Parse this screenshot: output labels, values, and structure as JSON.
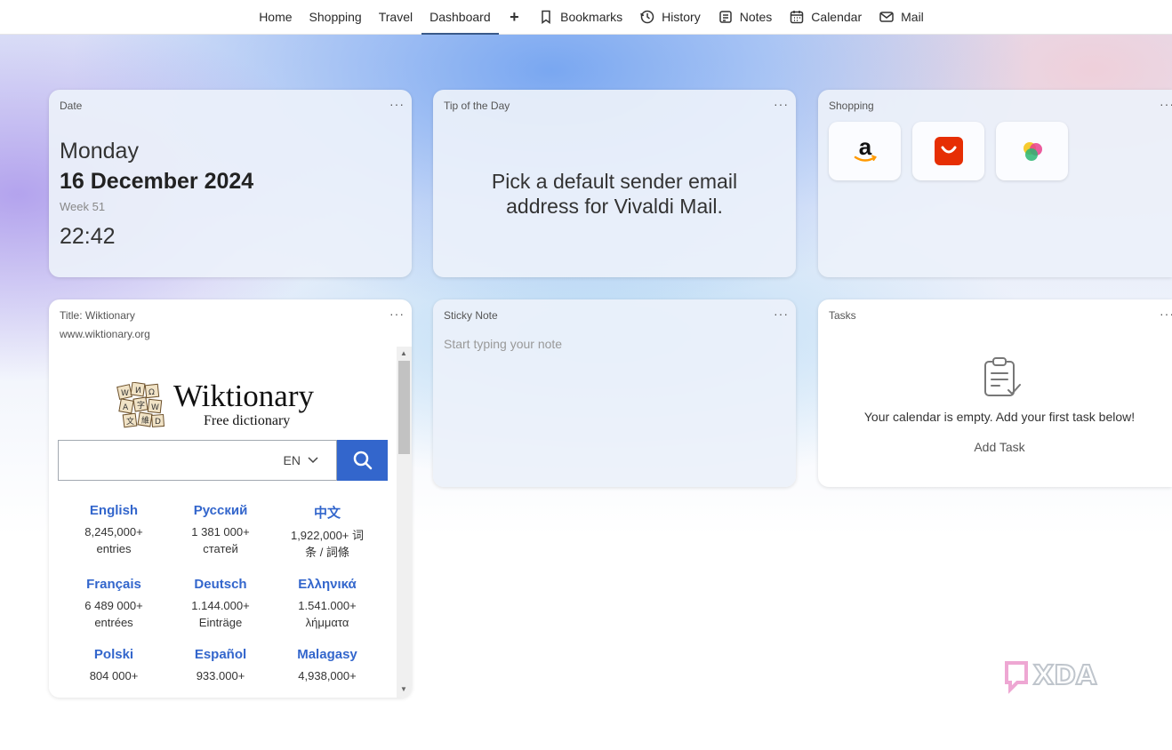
{
  "nav": {
    "home": "Home",
    "shopping": "Shopping",
    "travel": "Travel",
    "dashboard": "Dashboard",
    "add": "+",
    "bookmarks": "Bookmarks",
    "history": "History",
    "notes": "Notes",
    "calendar": "Calendar",
    "mail": "Mail",
    "active": "Dashboard"
  },
  "widgets": {
    "date": {
      "title": "Date",
      "menu": "···",
      "day": "Monday",
      "full_date": "16 December 2024",
      "week": "Week 51",
      "time": "22:42"
    },
    "tip": {
      "title": "Tip of the Day",
      "menu": "···",
      "text": "Pick a default sender email address for Vivaldi Mail."
    },
    "shopping": {
      "title": "Shopping",
      "menu": "···",
      "tiles": [
        "Amazon",
        "AliExpress",
        "Shopping app"
      ]
    },
    "webpanel": {
      "title": "Title: Wiktionary",
      "url": "www.wiktionary.org",
      "menu": "···",
      "site_title": "Wiktionary",
      "site_subtitle": "Free dictionary",
      "search_lang": "EN",
      "languages": [
        {
          "name": "English",
          "count": "8,245,000+",
          "unit": "entries"
        },
        {
          "name": "Русский",
          "count": "1 381 000+",
          "unit": "статей"
        },
        {
          "name": "中文",
          "count": "1,922,000+ 词",
          "unit": "条 / 詞條"
        },
        {
          "name": "Français",
          "count": "6 489 000+",
          "unit": "entrées"
        },
        {
          "name": "Deutsch",
          "count": "1.144.000+",
          "unit": "Einträge"
        },
        {
          "name": "Ελληνικά",
          "count": "1.541.000+",
          "unit": "λήμματα"
        },
        {
          "name": "Polski",
          "count": "804 000+",
          "unit": ""
        },
        {
          "name": "Español",
          "count": "933.000+",
          "unit": ""
        },
        {
          "name": "Malagasy",
          "count": "4,938,000+",
          "unit": ""
        }
      ]
    },
    "sticky": {
      "title": "Sticky Note",
      "menu": "···",
      "placeholder": "Start typing your note"
    },
    "tasks": {
      "title": "Tasks",
      "menu": "···",
      "empty_text": "Your calendar is empty. Add your first task below!",
      "add_label": "Add Task"
    }
  },
  "colors": {
    "accent": "#3366cc",
    "link": "#3366cc",
    "amazon_orange": "#ff9900",
    "aliexpress_red": "#e62e04"
  },
  "watermark": "XDA"
}
